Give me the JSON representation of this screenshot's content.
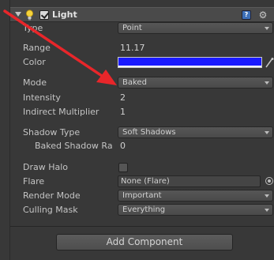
{
  "component": {
    "title": "Light",
    "enabled": true,
    "icon": "light-bulb-icon",
    "help_icon": "help-book-icon",
    "settings_icon": "gear-icon"
  },
  "properties": {
    "type": {
      "label": "Type",
      "value": "Point"
    },
    "range": {
      "label": "Range",
      "value": "11.17"
    },
    "color": {
      "label": "Color",
      "value": "#1a1aff"
    },
    "mode": {
      "label": "Mode",
      "value": "Baked"
    },
    "intensity": {
      "label": "Intensity",
      "value": "2"
    },
    "indirect_multiplier": {
      "label": "Indirect Multiplier",
      "value": "1"
    },
    "shadow_type": {
      "label": "Shadow Type",
      "value": "Soft Shadows"
    },
    "baked_shadow_radius": {
      "label": "Baked Shadow Ra",
      "value": "0"
    },
    "draw_halo": {
      "label": "Draw Halo",
      "checked": false
    },
    "flare": {
      "label": "Flare",
      "value": "None (Flare)"
    },
    "render_mode": {
      "label": "Render Mode",
      "value": "Important"
    },
    "culling_mask": {
      "label": "Culling Mask",
      "value": "Everything"
    }
  },
  "add_component": {
    "label": "Add Component"
  },
  "colors": {
    "panel_bg": "#383838",
    "annotation_arrow": "#e8262a"
  }
}
